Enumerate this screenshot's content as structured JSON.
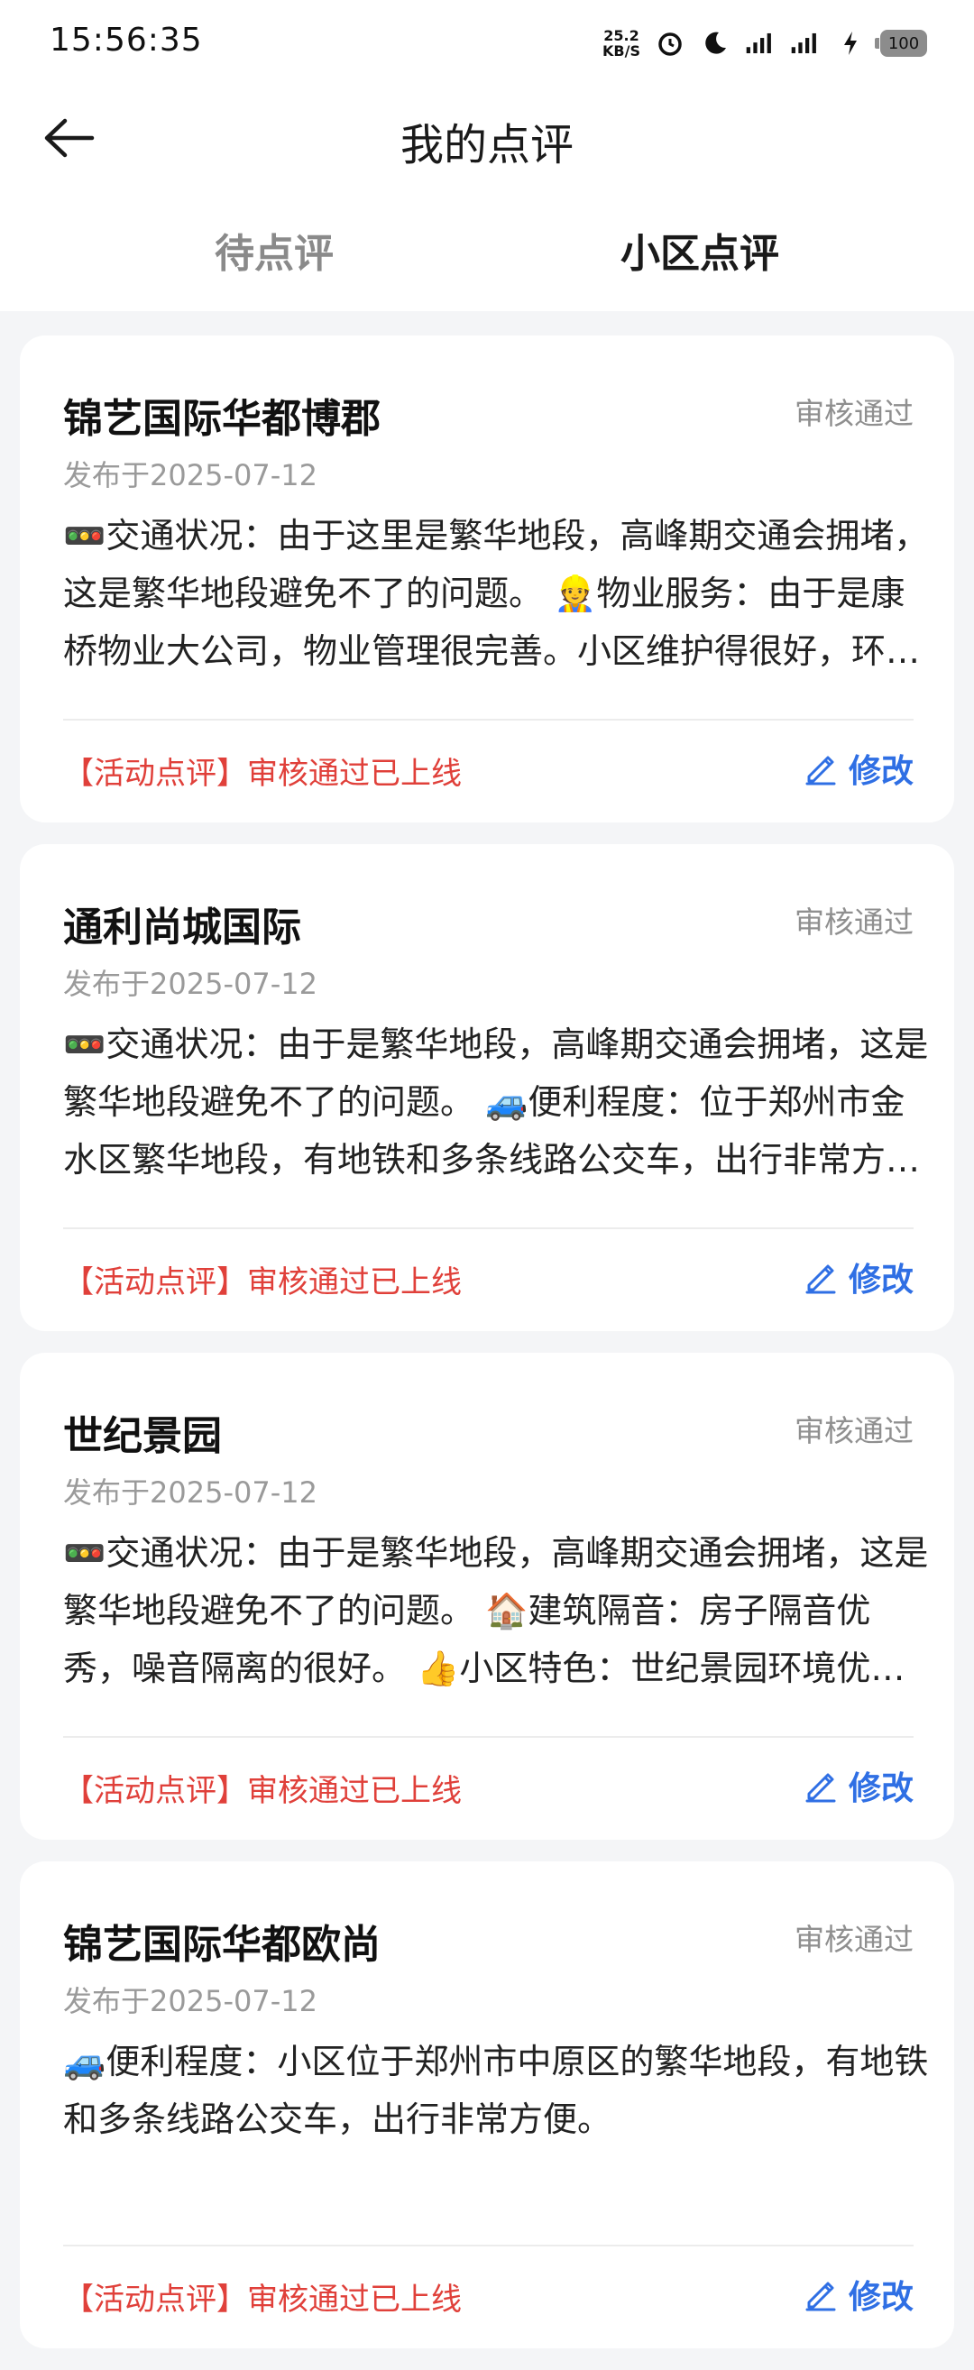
{
  "status_bar": {
    "time": "15:56:35",
    "net_speed_value": "25.2",
    "net_speed_unit": "KB/S",
    "battery": "100",
    "icons": [
      "alarm-icon",
      "moon-icon",
      "signal-icon",
      "signal-icon",
      "charging-icon"
    ]
  },
  "header": {
    "back_icon": "arrow-left-icon",
    "title": "我的点评"
  },
  "tabs": [
    {
      "label": "待点评",
      "active": false
    },
    {
      "label": "小区点评",
      "active": true
    }
  ],
  "colors": {
    "accent": "#2f6fe4",
    "tag_red": "#e0403a",
    "status_gray": "#8f8f8f"
  },
  "reviews": [
    {
      "name": "锦艺国际华都博郡",
      "status": "审核通过",
      "date": "发布于2025-07-12",
      "content": "🚥交通状况：由于这里是繁华地段，高峰期交通会拥堵，这是繁华地段避免不了的问题。 👷物业服务：由于是康桥物业大公司，物业管理很完善。小区维护得很好，环境整洁，绿化也不错。",
      "tag": "【活动点评】审核通过已上线",
      "edit_label": "修改"
    },
    {
      "name": "通利尚城国际",
      "status": "审核通过",
      "date": "发布于2025-07-12",
      "content": "🚥交通状况：由于是繁华地段，高峰期交通会拥堵，这是繁华地段避免不了的问题。 🚙便利程度：位于郑州市金水区繁华地段，有地铁和多条线路公交车，出行非常方便。",
      "tag": "【活动点评】审核通过已上线",
      "edit_label": "修改"
    },
    {
      "name": "世纪景园",
      "status": "审核通过",
      "date": "发布于2025-07-12",
      "content": "🚥交通状况：由于是繁华地段，高峰期交通会拥堵，这是繁华地段避免不了的问题。 🏠建筑隔音：房子隔音优秀，噪音隔离的很好。 👍小区特色：世纪景园环境优美，配套齐全。",
      "tag": "【活动点评】审核通过已上线",
      "edit_label": "修改"
    },
    {
      "name": "锦艺国际华都欧尚",
      "status": "审核通过",
      "date": "发布于2025-07-12",
      "content": "🚙便利程度：小区位于郑州市中原区的繁华地段，有地铁和多条线路公交车，出行非常方便。",
      "tag": "【活动点评】审核通过已上线",
      "edit_label": "修改"
    }
  ]
}
